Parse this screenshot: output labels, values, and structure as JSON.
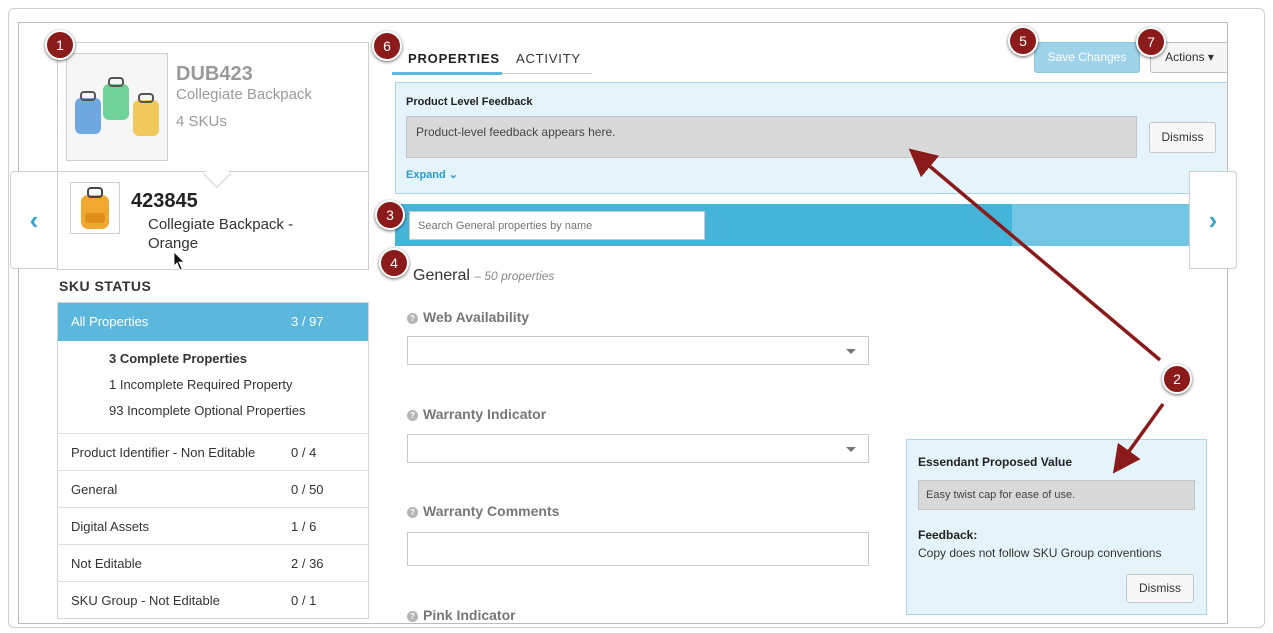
{
  "group": {
    "code": "DUB423",
    "name": "Collegiate Backpack",
    "skus": "4 SKUs"
  },
  "sku": {
    "code": "423845",
    "name": "Collegiate Backpack - Orange"
  },
  "sku_status": {
    "title": "SKU STATUS",
    "all_properties": {
      "label": "All Properties",
      "value": "3 / 97"
    },
    "breakdown": {
      "complete": "3 Complete Properties",
      "incomplete_required": "1 Incomplete Required Property",
      "incomplete_optional": "93 Incomplete Optional Properties"
    },
    "rows": [
      {
        "label": "Product Identifier - Non Editable",
        "value": "0 / 4"
      },
      {
        "label": "General",
        "value": "0 / 50"
      },
      {
        "label": "Digital Assets",
        "value": "1 / 6"
      },
      {
        "label": "Not Editable",
        "value": "2 / 36"
      },
      {
        "label": "SKU Group - Not Editable",
        "value": "0 / 1"
      }
    ]
  },
  "tabs": {
    "properties": "PROPERTIES",
    "activity": "ACTIVITY"
  },
  "toolbar": {
    "save_label": "Save Changes",
    "actions_label": "Actions ▾"
  },
  "product_feedback": {
    "title": "Product Level Feedback",
    "text": "Product-level feedback appears here.",
    "dismiss": "Dismiss",
    "expand": "Expand ⌄"
  },
  "search": {
    "placeholder": "Search General properties by name"
  },
  "general": {
    "title": "General",
    "subtitle": "– 50 properties"
  },
  "properties": {
    "web_availability": "Web Availability",
    "warranty_indicator": "Warranty Indicator",
    "warranty_comments": "Warranty Comments",
    "pink_indicator": "Pink Indicator"
  },
  "proposed": {
    "title": "Essendant Proposed Value",
    "value": "Easy twist cap for ease of use.",
    "feedback_label": "Feedback:",
    "feedback_text": "Copy does not follow SKU Group conventions",
    "dismiss": "Dismiss"
  },
  "annotations": [
    "1",
    "2",
    "3",
    "4",
    "5",
    "6",
    "7"
  ],
  "colors": {
    "accent": "#5bb7db",
    "search_band": "#45b4d9",
    "feedback_bg": "#e5f3fa",
    "badge": "#8b1b1b",
    "arrow": "#8b1b1b"
  }
}
